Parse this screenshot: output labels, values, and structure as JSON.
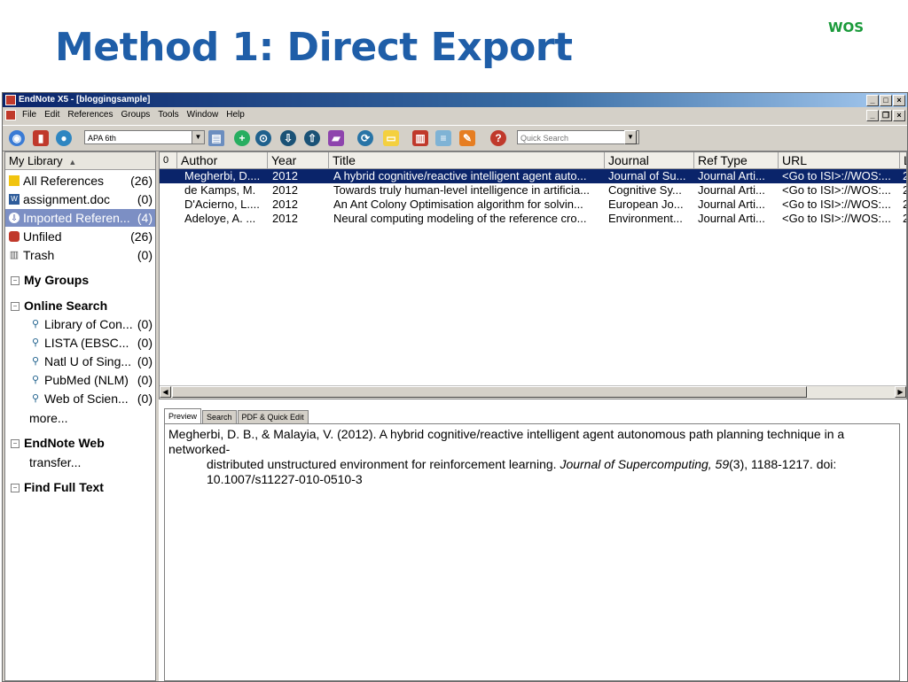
{
  "slide": {
    "title": "Method 1: Direct Export",
    "tag": "WOS"
  },
  "window": {
    "title": "EndNote X5 - [bloggingsample]",
    "controls": [
      "_",
      "□",
      "×"
    ],
    "mdi_controls": [
      "_",
      "❐",
      "×"
    ]
  },
  "menu": [
    "File",
    "Edit",
    "References",
    "Groups",
    "Tools",
    "Window",
    "Help"
  ],
  "toolbar": {
    "style": "APA 6th",
    "quick_search_placeholder": "Quick Search",
    "icons": [
      "globe-icon",
      "library-icon",
      "online-icon",
      "insert-citation-icon",
      "add-icon",
      "find-icon",
      "download-icon",
      "upload-icon",
      "folder-icon",
      "sync-icon",
      "note-icon",
      "pdf-icon",
      "format-icon",
      "edit-icon",
      "help-icon"
    ]
  },
  "sidebar": {
    "header": "My Library",
    "groups": [
      {
        "label": "All References",
        "count": "(26)",
        "icon": "all-refs-icon"
      },
      {
        "label": "assignment.doc",
        "count": "(0)",
        "icon": "word-doc-icon"
      },
      {
        "label": "Imported Referen...",
        "count": "(4)",
        "icon": "import-icon",
        "selected": true
      },
      {
        "label": "Unfiled",
        "count": "(26)",
        "icon": "unfiled-icon"
      },
      {
        "label": "Trash",
        "count": "(0)",
        "icon": "trash-icon"
      }
    ],
    "my_groups": "My Groups",
    "online_search": {
      "label": "Online Search",
      "items": [
        {
          "label": "Library of Con...",
          "count": "(0)"
        },
        {
          "label": "LISTA (EBSC...",
          "count": "(0)"
        },
        {
          "label": "Natl U of Sing...",
          "count": "(0)"
        },
        {
          "label": "PubMed (NLM)",
          "count": "(0)"
        },
        {
          "label": "Web of Scien...",
          "count": "(0)"
        }
      ],
      "more": "more..."
    },
    "endnote_web": {
      "label": "EndNote Web",
      "transfer": "transfer..."
    },
    "find_full_text": "Find Full Text"
  },
  "ref_table": {
    "columns": [
      "Author",
      "Year",
      "Title",
      "Journal",
      "Ref Type",
      "URL",
      "L"
    ],
    "rows": [
      {
        "author": "Megherbi, D....",
        "year": "2012",
        "title": "A hybrid cognitive/reactive intelligent agent auto...",
        "journal": "Journal of Su...",
        "ref_type": "Journal Arti...",
        "url": "<Go to ISI>://WOS:...",
        "last": "2",
        "selected": true
      },
      {
        "author": "de Kamps, M.",
        "year": "2012",
        "title": "Towards truly human-level intelligence in artificia...",
        "journal": "Cognitive Sy...",
        "ref_type": "Journal Arti...",
        "url": "<Go to ISI>://WOS:...",
        "last": "2"
      },
      {
        "author": "D'Acierno, L....",
        "year": "2012",
        "title": "An Ant Colony Optimisation algorithm for solvin...",
        "journal": "European Jo...",
        "ref_type": "Journal Arti...",
        "url": "<Go to ISI>://WOS:...",
        "last": "2"
      },
      {
        "author": "Adeloye, A. ...",
        "year": "2012",
        "title": "Neural computing modeling of the reference cro...",
        "journal": "Environment...",
        "ref_type": "Journal Arti...",
        "url": "<Go to ISI>://WOS:...",
        "last": "2"
      }
    ]
  },
  "tabs": [
    "Preview",
    "Search",
    "PDF & Quick Edit"
  ],
  "preview": {
    "line1": "Megherbi, D. B., & Malayia, V. (2012). A hybrid cognitive/reactive intelligent agent autonomous path planning technique in a networked-",
    "line2_pre": "distributed unstructured environment for reinforcement learning. ",
    "journal": "Journal of Supercomputing, 59",
    "line2_post": "(3), 1188-1217. doi:",
    "line3": "10.1007/s11227-010-0510-3"
  }
}
